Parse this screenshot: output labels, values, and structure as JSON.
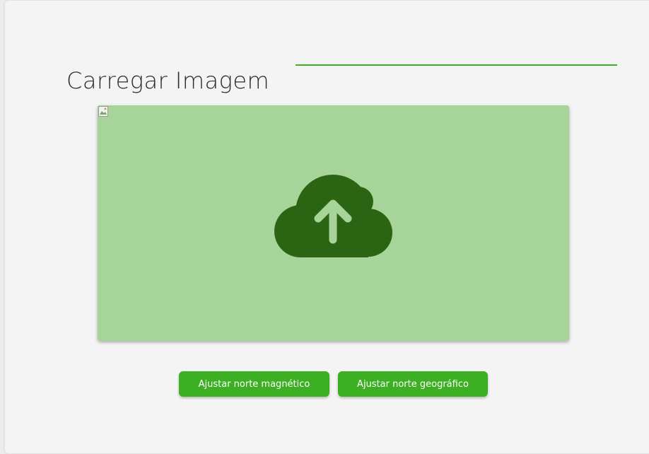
{
  "section": {
    "title": "Carregar Imagem"
  },
  "upload": {
    "icon": "cloud-upload-icon",
    "background_color": "#a7d499",
    "icon_color": "#2b6413"
  },
  "actions": {
    "magnetic_label": "Ajustar norte magnético",
    "geographic_label": "Ajustar norte geográfico"
  },
  "colors": {
    "accent": "#3daf22"
  }
}
